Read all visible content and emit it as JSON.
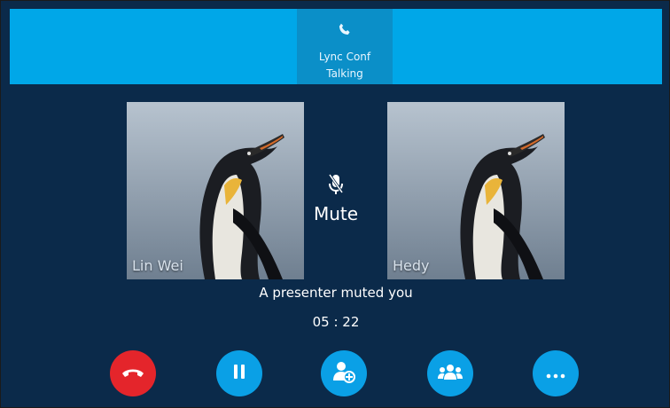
{
  "call": {
    "tab_label": "Lync Conf",
    "tab_status": "Talking",
    "tab_icon": "phone-icon"
  },
  "participants": [
    {
      "name": "Lin Wei",
      "avatar": "penguin-avatar"
    },
    {
      "name": "Hedy",
      "avatar": "penguin-avatar"
    }
  ],
  "status": {
    "mute_label": "Mute",
    "mute_icon": "microphone-muted-icon",
    "notice": "A presenter muted you",
    "duration": "05 : 22"
  },
  "actions": [
    {
      "name": "end-call",
      "icon": "hang-up-icon",
      "color": "#e4252b"
    },
    {
      "name": "hold",
      "icon": "pause-icon",
      "color": "#0aa0e6"
    },
    {
      "name": "add-participant",
      "icon": "add-person-icon",
      "color": "#0aa0e6"
    },
    {
      "name": "participants",
      "icon": "group-icon",
      "color": "#0aa0e6"
    },
    {
      "name": "more",
      "icon": "more-icon",
      "color": "#0aa0e6"
    }
  ],
  "colors": {
    "header_bg": "#00a7e8",
    "active_tab_bg": "#0b8fc8",
    "content_bg": "#0b2a4a"
  }
}
